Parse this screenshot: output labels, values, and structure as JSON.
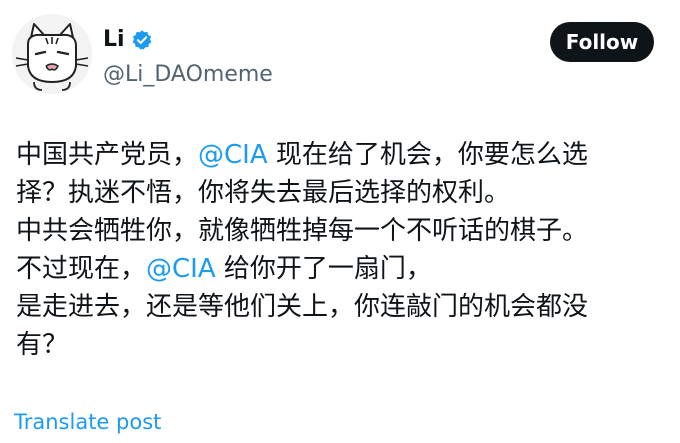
{
  "author": {
    "display_name": "Li",
    "handle": "@Li_DAOmeme",
    "avatar_icon": "cartoon-cat-avatar",
    "verified_icon": "verified-badge-icon"
  },
  "follow_label": "Follow",
  "post": {
    "lines": [
      {
        "before": "中国共产党员，",
        "mention": "@CIA",
        "after": " 现在给了机会，你要怎么选"
      },
      {
        "before": "择？执迷不悟，你将失去最后选择的权利。",
        "mention": "",
        "after": ""
      },
      {
        "before": "中共会牺牲你，就像牺牲掉每一个不听话的棋子。",
        "mention": "",
        "after": ""
      },
      {
        "before": "不过现在，",
        "mention": "@CIA",
        "after": " 给你开了一扇门，"
      },
      {
        "before": "是走进去，还是等他们关上，你连敲门的机会都没",
        "mention": "",
        "after": ""
      },
      {
        "before": "有？",
        "mention": "",
        "after": ""
      }
    ]
  },
  "translate_label": "Translate post",
  "colors": {
    "link": "#1d9bf0",
    "text": "#0f1419",
    "secondary_text": "#536471",
    "follow_bg": "#0f1419"
  }
}
